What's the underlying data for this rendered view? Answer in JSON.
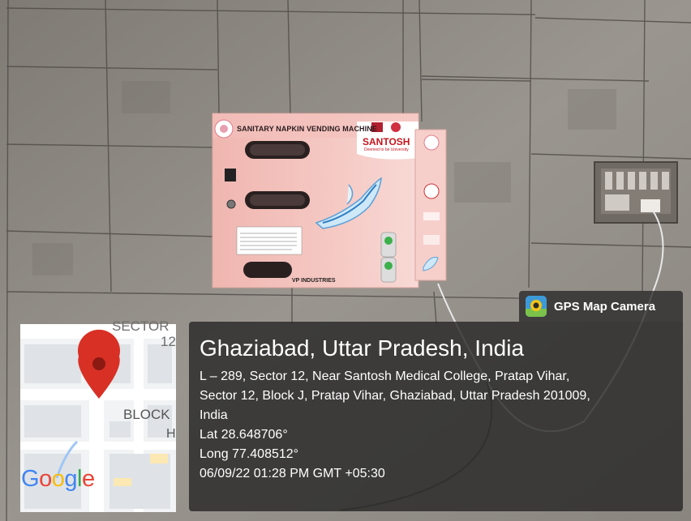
{
  "photo": {
    "machine": {
      "title": "SANITARY NAPKIN VENDING MACHINE",
      "brand": "SANTOSH",
      "brand_tagline": "Deemed to be University",
      "maker": "VP INDUSTRIES"
    }
  },
  "map": {
    "label_sector": "SECTOR",
    "label_sector_num": "12",
    "label_block": "BLOCK",
    "label_block_suffix": "H",
    "logo_text": [
      "G",
      "o",
      "o",
      "g",
      "l",
      "e"
    ],
    "pin_color": "#d93025"
  },
  "badge": {
    "icon": "gps-map-camera-icon",
    "label": "GPS Map Camera"
  },
  "info": {
    "city": "Ghaziabad, Uttar Pradesh, India",
    "address_line_1": "L – 289, Sector 12, Near Santosh Medical College, Pratap Vihar,",
    "address_line_2": "Sector 12, Block J, Pratap Vihar, Ghaziabad, Uttar Pradesh 201009,",
    "address_line_3": "India",
    "lat": "Lat 28.648706°",
    "long": "Long 77.408512°",
    "timestamp": "06/09/22 01:28 PM GMT +05:30"
  },
  "colors": {
    "machine_pink": "#f1b9b4",
    "wall": "#8c8781",
    "overlay": "#282828"
  }
}
